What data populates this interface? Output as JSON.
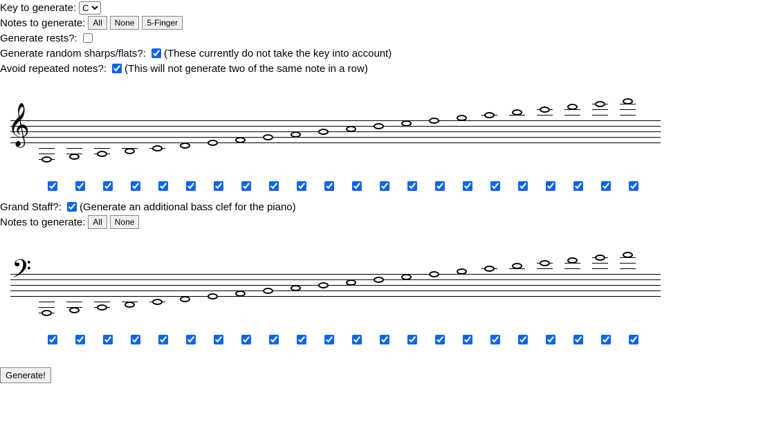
{
  "key": {
    "label": "Key to generate:",
    "value": "C",
    "options": [
      "C"
    ]
  },
  "notesTop": {
    "label": "Notes to generate:",
    "allBtn": "All",
    "noneBtn": "None",
    "fiveFingerBtn": "5-Finger"
  },
  "rests": {
    "label": "Generate rests?:",
    "checked": false
  },
  "accidentals": {
    "label": "Generate random sharps/flats?:",
    "checked": true,
    "hint": "(These currently do not take the key into account)"
  },
  "avoidRepeat": {
    "label": "Avoid repeated notes?:",
    "checked": true,
    "hint": "(This will not generate two of the same note in a row)"
  },
  "grandStaff": {
    "label": "Grand Staff?:",
    "checked": true,
    "hint": "(Generate an additional bass clef for the piano)"
  },
  "notesBottom": {
    "label": "Notes to generate:",
    "allBtn": "All",
    "noneBtn": "None"
  },
  "generateBtn": "Generate!",
  "trebleNotes": {
    "count": 22,
    "allChecked": true
  },
  "bassNotes": {
    "count": 22,
    "allChecked": true
  }
}
